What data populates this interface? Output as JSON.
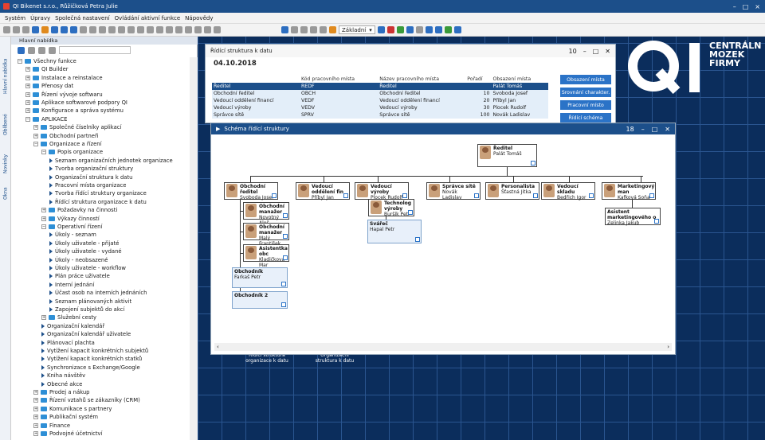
{
  "window": {
    "title": "QI Bikenet s.r.o., Růžičková Petra Julie",
    "controls": [
      "–",
      "□",
      "×"
    ]
  },
  "menu": [
    "Systém",
    "Úpravy",
    "Společná nastavení",
    "Ovládání aktivní funkce",
    "Nápovědy"
  ],
  "toolbar": {
    "profile": "Základní"
  },
  "sidebar": {
    "header": "Hlavní nabídka",
    "vtabs": [
      "Hlavní nabídka",
      "Oblíbené",
      "Novinky",
      "Okna"
    ],
    "tree": [
      {
        "l": "Všechny funkce",
        "d": 0,
        "t": "f",
        "e": "−"
      },
      {
        "l": "QI Builder",
        "d": 1,
        "t": "f",
        "e": "+"
      },
      {
        "l": "Instalace a reinstalace",
        "d": 1,
        "t": "f",
        "e": "+"
      },
      {
        "l": "Přenosy dat",
        "d": 1,
        "t": "f",
        "e": "+"
      },
      {
        "l": "Řízení vývoje softwaru",
        "d": 1,
        "t": "f",
        "e": "+"
      },
      {
        "l": "Aplikace softwarové podpory QI",
        "d": 1,
        "t": "f",
        "e": "+"
      },
      {
        "l": "Konfigurace a správa systému",
        "d": 1,
        "t": "f",
        "e": "+"
      },
      {
        "l": "APLIKACE",
        "d": 1,
        "t": "f",
        "e": "−"
      },
      {
        "l": "Společné číselníky aplikací",
        "d": 2,
        "t": "f",
        "e": "+"
      },
      {
        "l": "Obchodní partneři",
        "d": 2,
        "t": "f",
        "e": "+"
      },
      {
        "l": "Organizace a řízení",
        "d": 2,
        "t": "f",
        "e": "−"
      },
      {
        "l": "Popis organizace",
        "d": 3,
        "t": "f",
        "e": "−"
      },
      {
        "l": "Seznam organizačních jednotek organizace",
        "d": 4,
        "t": "a"
      },
      {
        "l": "Tvorba organizační struktury",
        "d": 4,
        "t": "a"
      },
      {
        "l": "Organizační struktura k datu",
        "d": 4,
        "t": "a"
      },
      {
        "l": "Pracovní místa organizace",
        "d": 4,
        "t": "a"
      },
      {
        "l": "Tvorba řídící struktury organizace",
        "d": 4,
        "t": "a"
      },
      {
        "l": "Řídící struktura organizace k datu",
        "d": 4,
        "t": "a"
      },
      {
        "l": "Požadavky na činnosti",
        "d": 3,
        "t": "f",
        "e": "+"
      },
      {
        "l": "Výkazy činností",
        "d": 3,
        "t": "f",
        "e": "+"
      },
      {
        "l": "Operativní řízení",
        "d": 3,
        "t": "f",
        "e": "−"
      },
      {
        "l": "Úkoly - seznam",
        "d": 4,
        "t": "a"
      },
      {
        "l": "Úkoly uživatele - přijaté",
        "d": 4,
        "t": "a"
      },
      {
        "l": "Úkoly uživatele - vydané",
        "d": 4,
        "t": "a"
      },
      {
        "l": "Úkoly - neobsazené",
        "d": 4,
        "t": "a"
      },
      {
        "l": "Úkoly uživatele - workflow",
        "d": 4,
        "t": "a"
      },
      {
        "l": "Plán práce uživatele",
        "d": 4,
        "t": "a"
      },
      {
        "l": "Interní jednání",
        "d": 4,
        "t": "a"
      },
      {
        "l": "Účast osob na interních jednáních",
        "d": 4,
        "t": "a"
      },
      {
        "l": "Seznam plánovaných aktivit",
        "d": 4,
        "t": "a"
      },
      {
        "l": "Zapojení subjektů do akcí",
        "d": 4,
        "t": "a"
      },
      {
        "l": "Služební cesty",
        "d": 3,
        "t": "f",
        "e": "+"
      },
      {
        "l": "Organizační kalendář",
        "d": 3,
        "t": "a"
      },
      {
        "l": "Organizační kalendář uživatele",
        "d": 3,
        "t": "a"
      },
      {
        "l": "Plánovací plachta",
        "d": 3,
        "t": "a"
      },
      {
        "l": "Vytížení kapacit konkrétních subjektů",
        "d": 3,
        "t": "a"
      },
      {
        "l": "Vytížení kapacit konkrétních statků",
        "d": 3,
        "t": "a"
      },
      {
        "l": "Synchronizace s Exchange/Google",
        "d": 3,
        "t": "a"
      },
      {
        "l": "Kniha návštěv",
        "d": 3,
        "t": "a"
      },
      {
        "l": "Obecné akce",
        "d": 3,
        "t": "a"
      },
      {
        "l": "Prodej a nákup",
        "d": 2,
        "t": "f",
        "e": "+"
      },
      {
        "l": "Řízení vztahů se zákazníky (CRM)",
        "d": 2,
        "t": "f",
        "e": "+"
      },
      {
        "l": "Komunikace s partnery",
        "d": 2,
        "t": "f",
        "e": "+"
      },
      {
        "l": "Publikační systém",
        "d": 2,
        "t": "f",
        "e": "+"
      },
      {
        "l": "Finance",
        "d": 2,
        "t": "f",
        "e": "+"
      },
      {
        "l": "Podvojné účetnictví",
        "d": 2,
        "t": "f",
        "e": "+"
      }
    ]
  },
  "brand": {
    "l1": "CENTRÁLN",
    "l2": "MOZEK",
    "l3": "FIRMY"
  },
  "w1": {
    "title": "Řídící struktura k datu",
    "count": "10",
    "date": "04.10.2018",
    "cols": [
      "",
      "Kód pracovního místa",
      "Název pracovního místa",
      "Pořadí",
      "Obsazení místa"
    ],
    "rows": [
      [
        "Ředitel",
        "REDF",
        "Ředitel",
        "",
        "Palát Tomáš"
      ],
      [
        "Obchodní ředitel",
        "OBCH",
        "Obchodní ředitel",
        "10",
        "Svoboda Josef"
      ],
      [
        "Vedoucí oddělení financí",
        "VEDF",
        "Vedoucí oddělení financí",
        "20",
        "Příbyl Jan"
      ],
      [
        "Vedoucí výroby",
        "VEDV",
        "Vedoucí výroby",
        "30",
        "Plocek Rudolf"
      ],
      [
        "Správce sítě",
        "SPRV",
        "Správce sítě",
        "100",
        "Novák Ladislav"
      ]
    ],
    "buttons": [
      "Obsazení místa",
      "Srovnání charakter.",
      "Pracovní místo",
      "Řídící schéma"
    ]
  },
  "w2": {
    "title": "Schéma řídící struktury",
    "count": "18",
    "nodes": {
      "root": {
        "t": "Ředitel",
        "n": "Palát Tomáš"
      },
      "c1": {
        "t": "Obchodní ředitel",
        "n": "Svoboda Josef"
      },
      "c2": {
        "t": "Vedoucí oddělení fin",
        "n": "Příbyl Jan"
      },
      "c3": {
        "t": "Vedoucí výroby",
        "n": "Plocek Rudolf"
      },
      "c4": {
        "t": "Správce sítě",
        "n": "Novák Ladislav"
      },
      "c5": {
        "t": "Personalista",
        "n": "Šťastná Jitka"
      },
      "c6": {
        "t": "Vedoucí skladu",
        "n": "Bedřich Igor"
      },
      "c7": {
        "t": "Marketingový man",
        "n": "Kafková Soňa"
      },
      "s1": {
        "t": "Obchodní manažer",
        "n": "Novotný Aleš"
      },
      "s2": {
        "t": "Obchodní manažer",
        "n": "Malý František"
      },
      "s3": {
        "t": "Asistentka obc",
        "n": "Kladičková Mar"
      },
      "s4": {
        "t": "Obchodník",
        "n": "Farkaš Petr"
      },
      "s5": {
        "t": "Obchodník 2",
        "n": ""
      },
      "v1": {
        "t": "Technolog výroby",
        "n": "Buršík Petr"
      },
      "v2": {
        "t": "Svářeč",
        "n": "Hapal Petr"
      },
      "m1": {
        "t": "Asistent marketingového o",
        "n": "Zelinka Jakub"
      }
    }
  },
  "desk": {
    "icons": [
      "Řídící struktura organizace k datu",
      "Organizační struktura k datu"
    ]
  }
}
